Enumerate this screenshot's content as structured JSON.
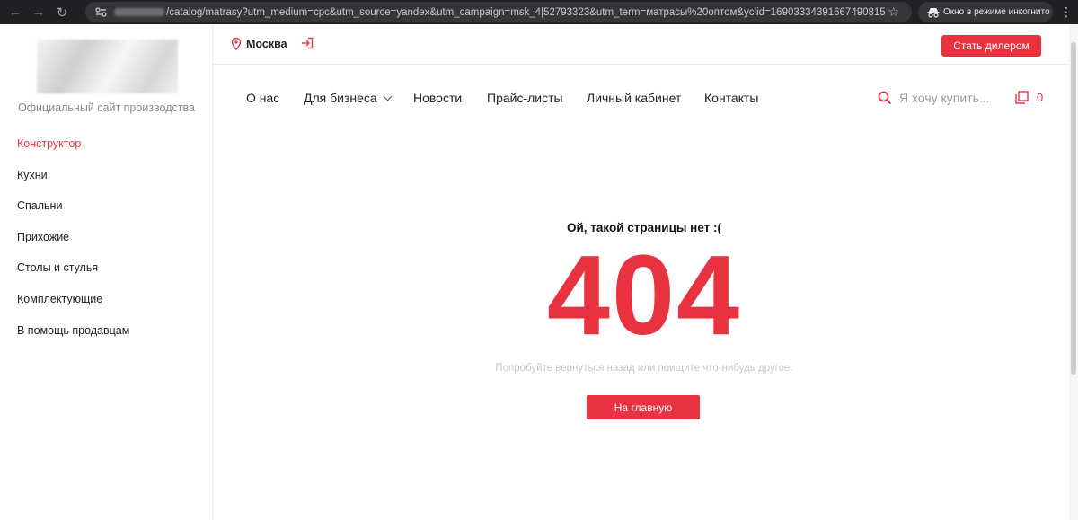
{
  "browser": {
    "url_path": "/catalog/matrasy?utm_medium=cpc&utm_source=yandex&utm_campaign=msk_4|52793323&utm_term=матрасы%20оптом&yclid=16903334391667490815",
    "incognito_label": "Окно в режиме инкогнито",
    "icons": [
      "back-icon",
      "forward-icon",
      "reload-icon",
      "site-settings-icon",
      "bookmark-star-icon",
      "incognito-icon"
    ]
  },
  "sidebar": {
    "tagline": "Официальный сайт производства",
    "items": [
      {
        "label": "Конструктор",
        "active": true
      },
      {
        "label": "Кухни"
      },
      {
        "label": "Спальни"
      },
      {
        "label": "Прихожие"
      },
      {
        "label": "Столы и стулья"
      },
      {
        "label": "Комплектующие"
      },
      {
        "label": "В помощь продавцам"
      }
    ]
  },
  "topbar": {
    "city": "Москва",
    "dealer_button": "Стать дилером"
  },
  "nav": {
    "items": [
      "О нас",
      "Для бизнеса",
      "Новости",
      "Прайс-листы",
      "Личный кабинет",
      "Контакты"
    ],
    "search_placeholder": "Я хочу купить...",
    "cart_count": "0"
  },
  "error": {
    "title": "Ой, такой страницы нет :(",
    "code": "404",
    "hint": "Попробуйте вернуться назад или поищите что-нибудь другое.",
    "home_button": "На главную"
  },
  "colors": {
    "accent": "#e8323f",
    "chrome_bg": "#202124",
    "omnibox_bg": "#35363a"
  }
}
